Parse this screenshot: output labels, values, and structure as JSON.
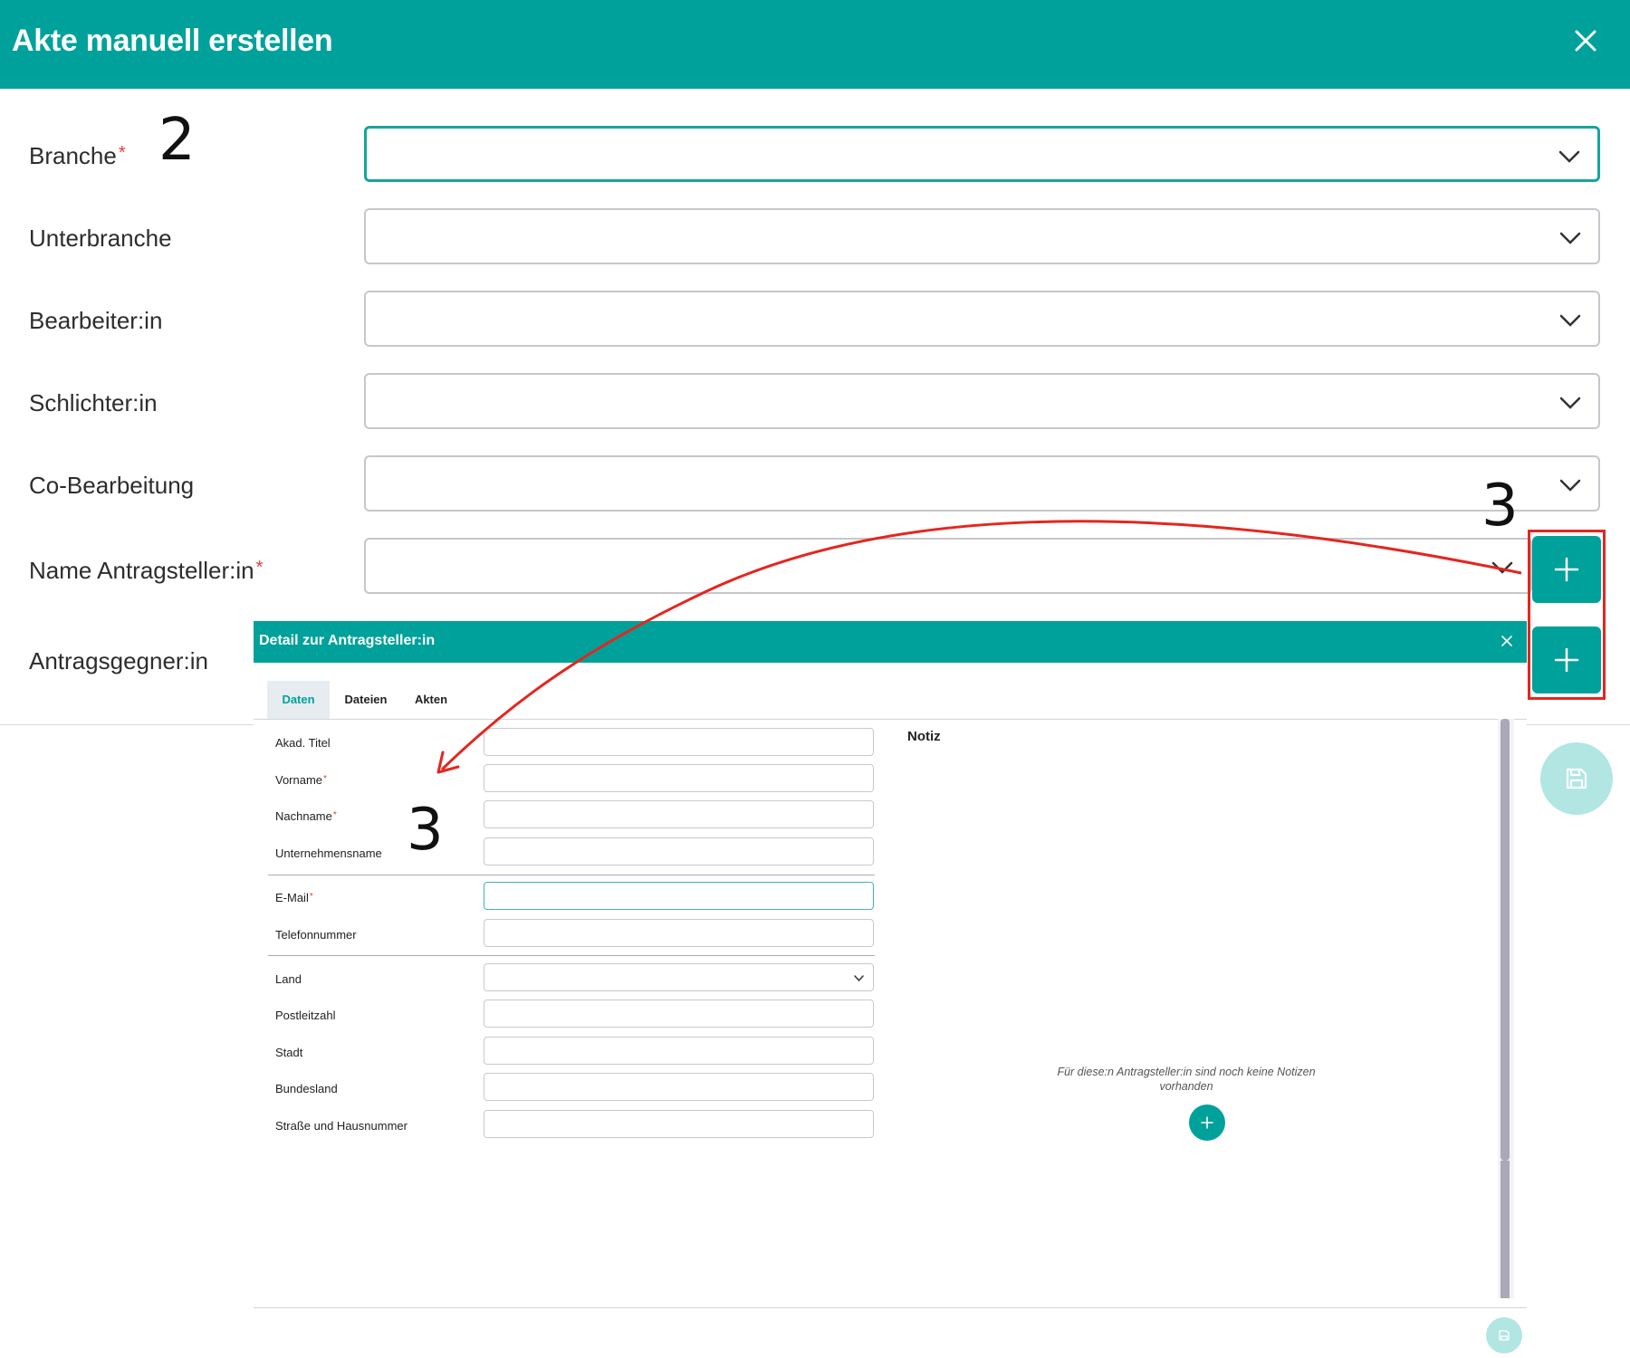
{
  "main": {
    "title": "Akte manuell erstellen",
    "fields": {
      "branche": {
        "label": "Branche",
        "required": "*"
      },
      "unterbranche": {
        "label": "Unterbranche"
      },
      "bearbeiter": {
        "label": "Bearbeiter:in"
      },
      "schlichter": {
        "label": "Schlichter:in"
      },
      "cobearbeitung": {
        "label": "Co-Bearbeitung"
      },
      "antragsteller": {
        "label": "Name Antragsteller:in",
        "required": "*"
      },
      "antragsgegner": {
        "label": "Antragsgegner:in"
      }
    }
  },
  "annotations": {
    "step_two": "2",
    "step_three_top": "3",
    "step_three_dialog": "3",
    "highlight_color": "#e4261f"
  },
  "dialog": {
    "title": "Detail zur Antragsteller:in",
    "tabs": [
      "Daten",
      "Dateien",
      "Akten"
    ],
    "active_tab": "Daten",
    "fields": {
      "titel": {
        "label": "Akad. Titel"
      },
      "vorname": {
        "label": "Vorname",
        "required": "*"
      },
      "nachname": {
        "label": "Nachname",
        "required": "*"
      },
      "unternehmen": {
        "label": "Unternehmensname"
      },
      "email": {
        "label": "E-Mail",
        "required": "*"
      },
      "telefon": {
        "label": "Telefonnummer"
      },
      "land": {
        "label": "Land"
      },
      "plz": {
        "label": "Postleitzahl"
      },
      "stadt": {
        "label": "Stadt"
      },
      "bundesland": {
        "label": "Bundesland"
      },
      "strasse": {
        "label": "Straße und Hausnummer"
      }
    },
    "notiz": {
      "title": "Notiz",
      "empty_text": "Für diese:n Antragsteller:in sind noch keine Notizen vorhanden"
    }
  },
  "colors": {
    "brand": "#00a19a",
    "brand_light": "#b2e6e2",
    "required": "#e0413a"
  }
}
